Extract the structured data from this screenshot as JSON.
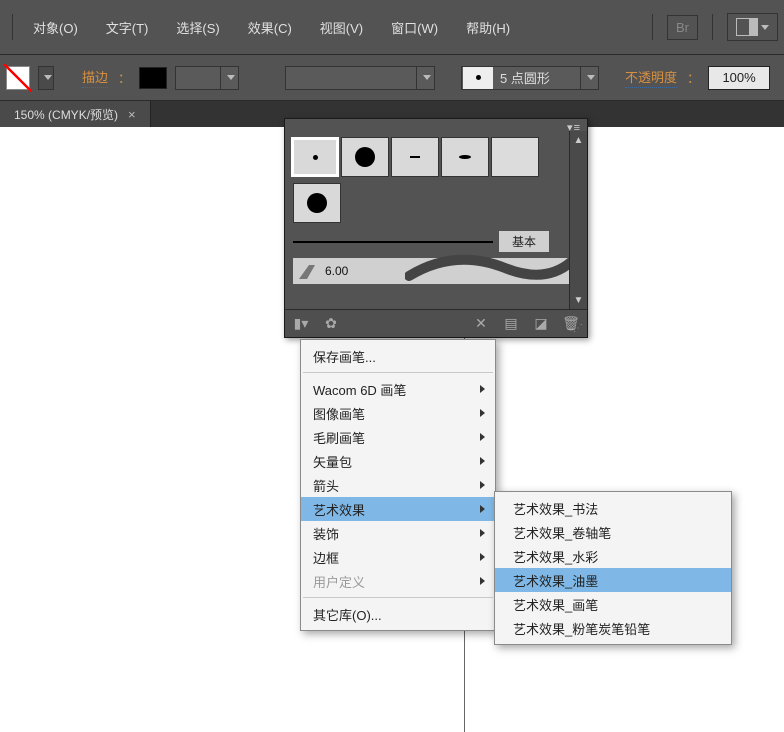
{
  "menubar": {
    "items": [
      "对象(O)",
      "文字(T)",
      "选择(S)",
      "效果(C)",
      "视图(V)",
      "窗口(W)",
      "帮助(H)"
    ],
    "br_label": "Br"
  },
  "optionsbar": {
    "stroke_label": "描边",
    "brush_label": "5 点圆形",
    "opacity_label": "不透明度",
    "opacity_value": "100%"
  },
  "doctab": {
    "title": "150% (CMYK/预览)",
    "close": "×"
  },
  "brush_panel": {
    "basic_label": "基本",
    "size_label": "6.00"
  },
  "context_menu": {
    "items": [
      {
        "label": "保存画笔...",
        "sub": false
      },
      {
        "sep": true
      },
      {
        "label": "Wacom 6D 画笔",
        "sub": true
      },
      {
        "label": "图像画笔",
        "sub": true
      },
      {
        "label": "毛刷画笔",
        "sub": true
      },
      {
        "label": "矢量包",
        "sub": true
      },
      {
        "label": "箭头",
        "sub": true
      },
      {
        "label": "艺术效果",
        "sub": true,
        "highlight": true
      },
      {
        "label": "装饰",
        "sub": true
      },
      {
        "label": "边框",
        "sub": true
      },
      {
        "label": "用户定义",
        "sub": true,
        "disabled": true
      },
      {
        "sep": true
      },
      {
        "label": "其它库(O)...",
        "sub": false
      }
    ]
  },
  "submenu": {
    "items": [
      {
        "label": "艺术效果_书法"
      },
      {
        "label": "艺术效果_卷轴笔"
      },
      {
        "label": "艺术效果_水彩"
      },
      {
        "label": "艺术效果_油墨",
        "highlight": true
      },
      {
        "label": "艺术效果_画笔"
      },
      {
        "label": "艺术效果_粉笔炭笔铅笔"
      }
    ]
  }
}
